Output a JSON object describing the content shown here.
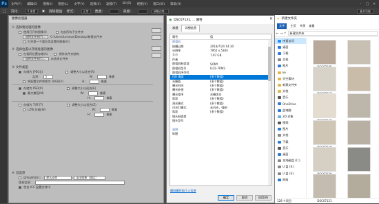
{
  "photoshop": {
    "logo": "Ps",
    "menu": [
      "文件(F)",
      "编辑(E)",
      "图像(I)",
      "图层(L)",
      "文字(Y)",
      "选择(S)",
      "滤镜(T)",
      "3D(D)",
      "视图(V)",
      "窗口(W)",
      "帮助(H)"
    ],
    "options": {
      "feather": "羽化：",
      "feather_value": "0 像素",
      "antialias": "消除锯齿",
      "style": "样式：",
      "style_value": "正常",
      "width": "宽度：",
      "height": "高度：",
      "refine": "调整边缘..."
    },
    "workspace": "基本功能"
  },
  "processor": {
    "title": "图像处理器",
    "sec1_title": "选择要处理的图像",
    "sec1_opt1": "使用打开的图像(I)",
    "sec1_opt1b": "包含所有子文件夹",
    "sec1_btn": "选择文件夹(F)...",
    "sec1_path": "C:\\Users\\Lenovo\\Desktop\\新建文件夹",
    "sec1_opt2": "打开第一个要应用设置的图像(O)",
    "sec2_title": "选择位置以存储处理的图像",
    "sec2_opt1": "在相同位置存储(A)",
    "sec2_opt1b": "保持文件夹结构",
    "sec2_btn": "选择文件夹(C)...",
    "sec2_path": "未选择文件夹",
    "sec3_title": "文件类型",
    "jpeg_label": "存储为 JPEG(J)",
    "resize1": "调整大小以适合(R)",
    "quality_label": "品质：",
    "quality_value": "5",
    "w_label": "W：",
    "h_label": "H：",
    "unit": "像素",
    "srgb": "将配置文件转换为 sRGB(V)",
    "psd_label": "存储为 PSD(P)",
    "resize2": "调整大小以适合(E)",
    "maximize": "最大兼容(M)",
    "tiff_label": "存储为 TIFF(T)",
    "resize3": "调整大小以适合(Z)",
    "lzw": "LZW 压缩(W)",
    "sec4_title": "首选项",
    "action_label": "运行动作(U)：",
    "action_set": "默认动作",
    "action_name": "淡出效果（选区）",
    "copyright_label": "版权信息：",
    "icc": "包含 ICC 配置文件(I)",
    "side": [
      "运行",
      "取消",
      "载入...",
      "存储..."
    ]
  },
  "properties": {
    "title": "DSC07131, ... 属性",
    "tabs": [
      "常规",
      "详细信息"
    ],
    "col_name": "属性",
    "col_value": "值",
    "rows": [
      {
        "name": "照相机",
        "value": "",
        "group": true
      },
      {
        "name": "拍摄日期",
        "value": "2018/7/24 14:30"
      },
      {
        "name": "分辨率",
        "value": "7952 x 5304"
      },
      {
        "name": "大小",
        "value": "7.97 GB"
      },
      {
        "name": "作者",
        "value": ""
      },
      {
        "name": "照相机制造商",
        "value": "SONY"
      },
      {
        "name": "照相机型号",
        "value": "ILCE-7RM2"
      },
      {
        "name": "照相机序列号",
        "value": ""
      },
      {
        "name": "ISO 速度",
        "value": "(多个数值)",
        "selected": true
      },
      {
        "name": "光圈值",
        "value": "(多个数值)"
      },
      {
        "name": "曝光时间",
        "value": "(多个数值)"
      },
      {
        "name": "曝光补偿",
        "value": "(多个数值)"
      },
      {
        "name": "曝光程序",
        "value": "光圈优先"
      },
      {
        "name": "焦距",
        "value": "(多个数值)"
      },
      {
        "name": "测光模式",
        "value": "(多个数值)"
      },
      {
        "name": "闪光灯模式",
        "value": "无闪光，强制"
      },
      {
        "name": "焦距",
        "value": "(多个数值)"
      },
      {
        "name": "镜头制造商",
        "value": ""
      },
      {
        "name": "镜头型号",
        "value": ""
      },
      {
        "name": "",
        "value": ""
      },
      {
        "name": "说明",
        "value": "",
        "group": true
      },
      {
        "name": "标题",
        "value": ""
      }
    ],
    "remove_link": "删除属性和个人信息",
    "ok": "确定",
    "cancel": "取消",
    "apply": "应用(A)"
  },
  "explorer": {
    "title": "新建文件夹",
    "ribbon": [
      "文件",
      "主页",
      "共享",
      "查看"
    ],
    "address": "新建文件夹",
    "nav": [
      {
        "label": "快速访问",
        "color": "#1e90ff",
        "sel": true
      },
      {
        "label": "桌面",
        "color": "#2b7bd6"
      },
      {
        "label": "下载",
        "color": "#2b7bd6"
      },
      {
        "label": "文档",
        "color": "#888888"
      },
      {
        "label": "图片",
        "color": "#2b7bd6"
      },
      {
        "label": "ke",
        "color": "#e0b84a"
      },
      {
        "label": "天空素材",
        "color": "#e0b84a"
      },
      {
        "label": "新建文件夹",
        "color": "#e0b84a"
      },
      {
        "label": "文档",
        "color": "#e0b84a"
      },
      {
        "label": "音乐",
        "color": "#555555"
      },
      {
        "label": "OneDrive",
        "color": "#2b7bd6"
      },
      {
        "label": "此电脑",
        "color": "#2b7bd6"
      },
      {
        "label": "3D 对象",
        "color": "#6ab0e6"
      },
      {
        "label": "视频",
        "color": "#555555"
      },
      {
        "label": "图片",
        "color": "#2b7bd6"
      },
      {
        "label": "文档",
        "color": "#888888"
      },
      {
        "label": "下载",
        "color": "#2b7bd6"
      },
      {
        "label": "音乐",
        "color": "#555555"
      },
      {
        "label": "桌面",
        "color": "#2b7bd6"
      },
      {
        "label": "本地磁盘 (C:)",
        "color": "#888888"
      },
      {
        "label": "U 盘 (E:)",
        "color": "#888888"
      },
      {
        "label": "U 盘 (E:)",
        "color": "#888888"
      },
      {
        "label": "网络",
        "color": "#2b7bd6"
      }
    ],
    "thumbs": [
      {
        "label": "DSC07105",
        "color": "#b9a99a"
      },
      {
        "label": "",
        "color": "#c7c0b3"
      },
      {
        "label": "DSC07117",
        "color": "#d8d3c9"
      },
      {
        "label": "",
        "color": "#c9bca8"
      },
      {
        "label": "DSC07118",
        "color": "#e3dccf"
      },
      {
        "label": "",
        "color": "#bdb6ab"
      },
      {
        "label": "DSC07119",
        "color": "#cfc6b6"
      },
      {
        "label": "",
        "color": "#b8b0a2"
      },
      {
        "label": "DSC07120",
        "color": "#d6d0c4"
      },
      {
        "label": "",
        "color": "#8a8a86"
      },
      {
        "label": "DSC07121",
        "color": "#c4bcaf"
      },
      {
        "label": "",
        "color": "#b3ab9c"
      }
    ],
    "status": "128 个项目"
  }
}
